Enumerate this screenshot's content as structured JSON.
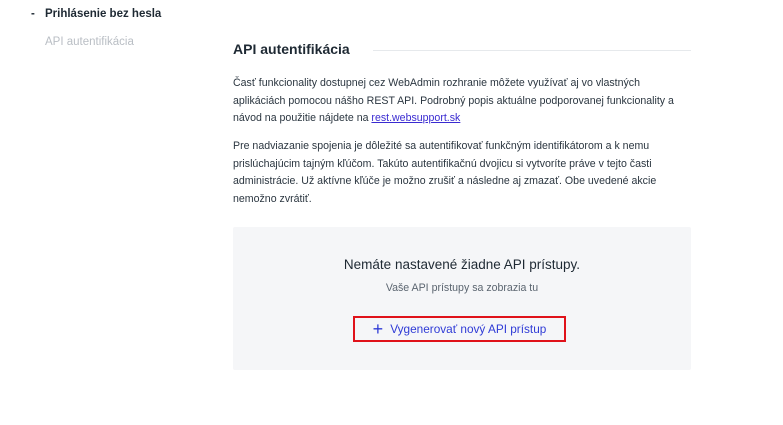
{
  "sidebar": {
    "active_item": "Prihlásenie bez hesla",
    "active_marker": "-",
    "item2": "API autentifikácia"
  },
  "section": {
    "title": "API autentifikácia",
    "p1_text": "Časť funkcionality dostupnej cez WebAdmin rozhranie môžete využívať aj vo vlastných aplikáciách pomocou nášho REST API. Podrobný popis aktuálne podporovanej funkcionality a návod na použitie nájdete na ",
    "p1_link": "rest.websupport.sk",
    "p2_text": "Pre nadviazanie spojenia je dôležité sa autentifikovať funkčným identifikátorom a k nemu prislúchajúcim tajným kľúčom. Takúto autentifikačnú dvojicu si vytvoríte práve v tejto časti administrácie. Už aktívne kľúče je možno zrušiť a následne aj zmazať. Obe uvedené akcie nemožno zvrátiť."
  },
  "empty_state": {
    "title": "Nemáte nastavené žiadne API prístupy.",
    "subtitle": "Vaše API prístupy sa zobrazia tu",
    "button_label": "Vygenerovať nový API prístup",
    "button_icon": "plus-icon",
    "highlight_color": "#e0121a",
    "accent_color": "#2f3bd6"
  }
}
